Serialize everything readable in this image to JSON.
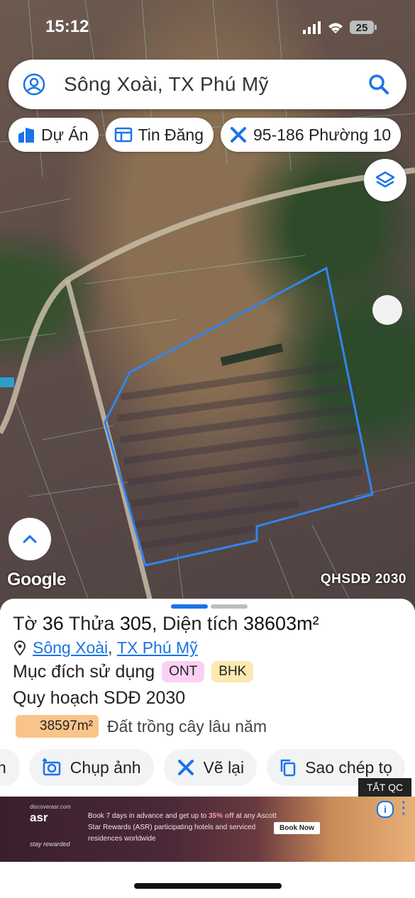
{
  "status_bar": {
    "time": "15:12",
    "battery": "25"
  },
  "search": {
    "query": "Sông Xoài, TX Phú Mỹ"
  },
  "chips": [
    {
      "label": "Dự Án",
      "icon": "building-icon"
    },
    {
      "label": "Tin Đăng",
      "icon": "listing-icon"
    },
    {
      "label": "95-186 Phường 10",
      "icon": "ruler-cross-icon"
    }
  ],
  "map": {
    "watermark": "Google",
    "overlay_label": "QHSDĐ 2030"
  },
  "parcel": {
    "title_prefix": "Tờ ",
    "sheet_no": "36",
    "title_mid": " Thửa ",
    "parcel_no": "305",
    "title_area_label": ", Diện tích ",
    "area": "38603m²",
    "location_ward": "Sông Xoài",
    "location_sep": ",",
    "location_town": "TX Phú Mỹ",
    "purpose_label": "Mục đích sử dụng",
    "purpose_tags": [
      "ONT",
      "BHK"
    ],
    "plan_label": "Quy hoạch SDĐ 2030",
    "plan_area": "38597m²",
    "plan_desc": "Đất trồng cây lâu năm"
  },
  "actions": [
    {
      "label": "h",
      "icon": ""
    },
    {
      "label": "Chụp ảnh",
      "icon": "camera-icon"
    },
    {
      "label": "Vẽ lại",
      "icon": "redraw-icon"
    },
    {
      "label": "Sao chép tọ",
      "icon": "copy-icon"
    }
  ],
  "ad": {
    "close_label": "TẮT QC",
    "brand": "asr",
    "brand_top": "discoverasr.com",
    "tagline": "stay rewarded",
    "text_part1": "Book 7 days in advance and get up to ",
    "text_highlight": "35% off",
    "text_part2": " at any Ascott Star Rewards (ASR) participating hotels and serviced residences worldwide",
    "cta": "Book Now"
  },
  "colors": {
    "accent": "#1a73e8",
    "parcel_outline": "#2f86f0",
    "ont_tag": "#fbd0f5",
    "bhk_tag": "#fbe9b0",
    "area_fill": "#f9c48a"
  }
}
